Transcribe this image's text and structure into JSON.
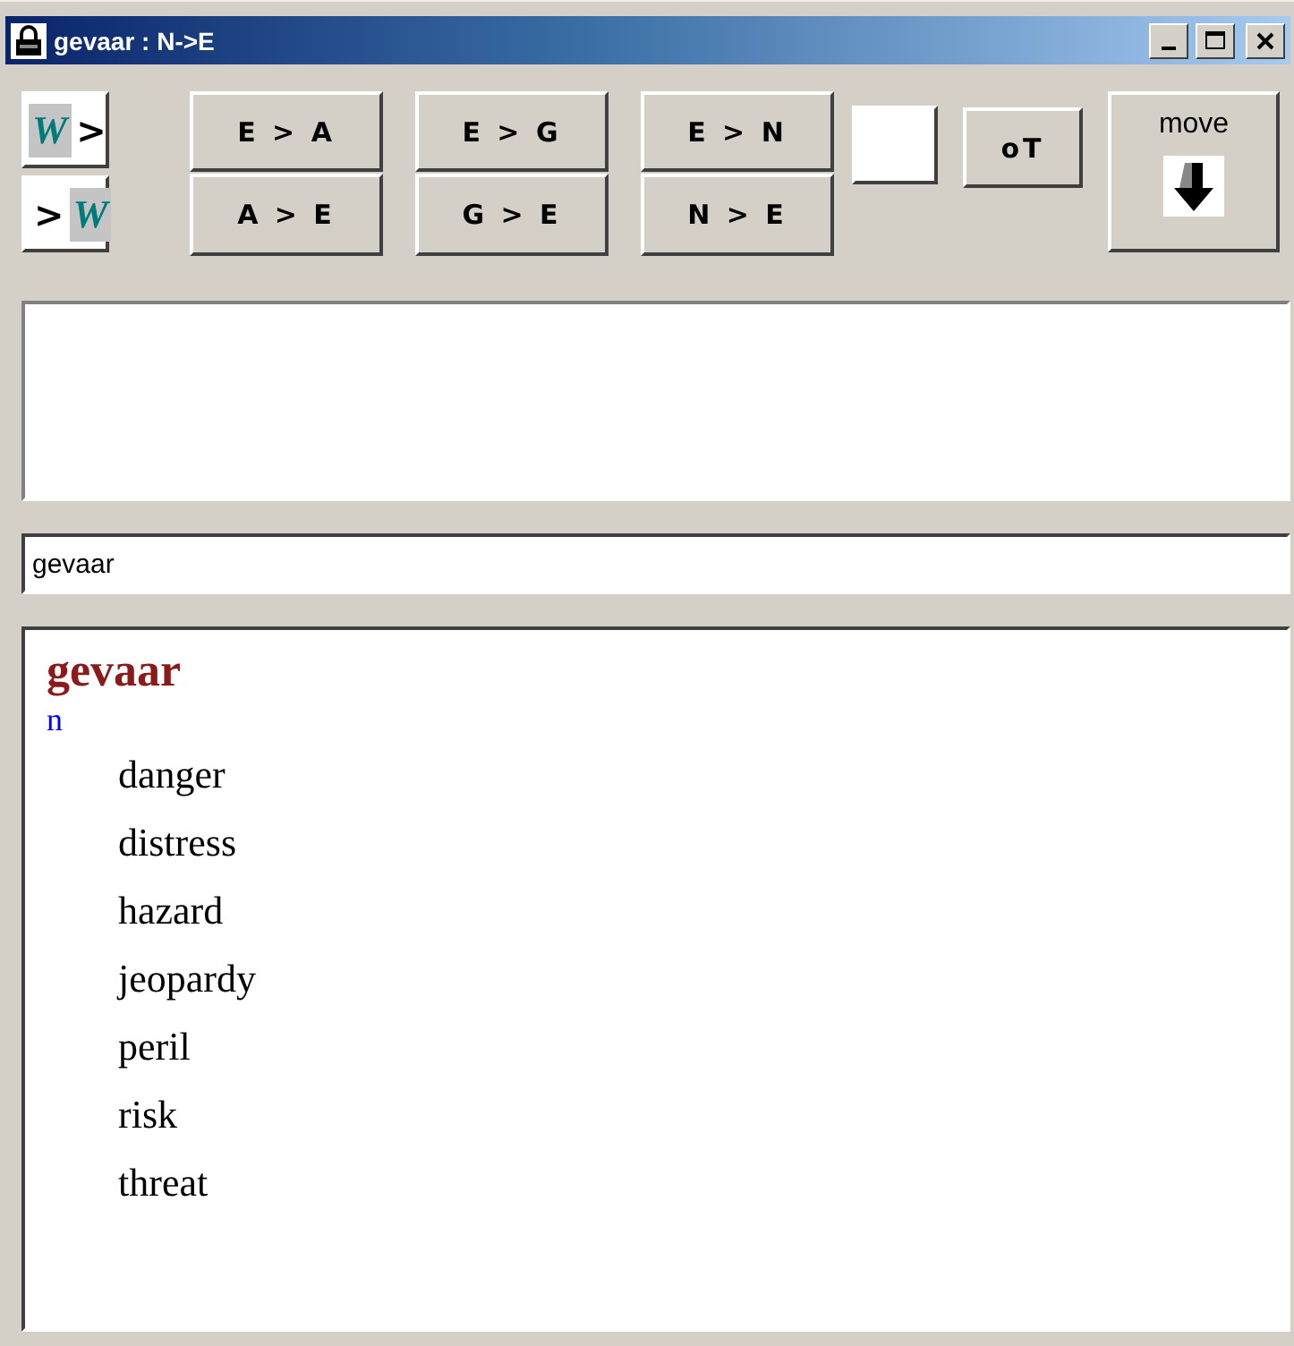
{
  "window": {
    "title": "gevaar : N->E"
  },
  "direction_buttons": [
    {
      "kind": "from",
      "logo": "W",
      "arrow": ">"
    },
    {
      "kind": "to",
      "logo": "W",
      "arrow": ">"
    }
  ],
  "pair_buttons": [
    {
      "top": "E > A",
      "bottom": "A > E"
    },
    {
      "top": "E > G",
      "bottom": "G > E"
    },
    {
      "top": "E > N",
      "bottom": "N > E"
    }
  ],
  "ot_button": {
    "label": "oT"
  },
  "move_button": {
    "label": "move"
  },
  "search": {
    "value": "gevaar"
  },
  "result": {
    "headword": "gevaar",
    "part_of_speech": "n",
    "senses": [
      "danger",
      "distress",
      "hazard",
      "jeopardy",
      "peril",
      "risk",
      "threat"
    ]
  }
}
